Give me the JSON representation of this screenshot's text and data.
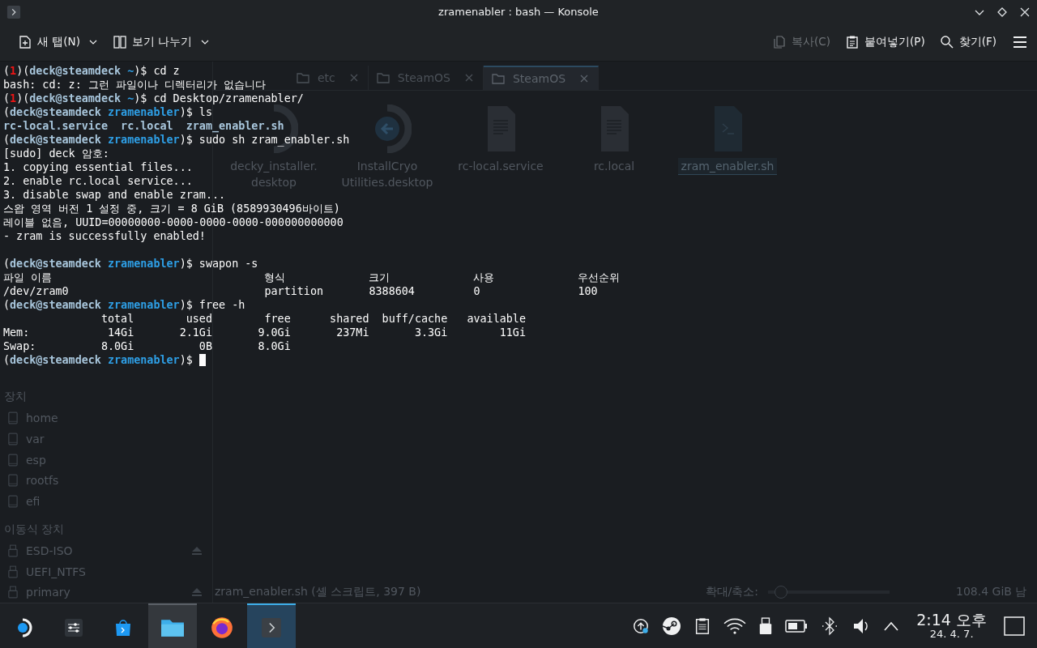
{
  "window": {
    "title": "zramenabler : bash — Konsole"
  },
  "toolbar": {
    "left": [
      {
        "label": "새 탭(N)",
        "kind": "new-tab",
        "disabled": false,
        "dropdown": true
      },
      {
        "label": "보기 나누기",
        "kind": "split",
        "disabled": false,
        "dropdown": true
      }
    ],
    "right": [
      {
        "label": "복사(C)",
        "kind": "copy",
        "disabled": true,
        "dropdown": false
      },
      {
        "label": "붙여넣기(P)",
        "kind": "paste",
        "disabled": false,
        "dropdown": false
      },
      {
        "label": "찾기(F)",
        "kind": "find",
        "disabled": false,
        "dropdown": false
      }
    ]
  },
  "background_window": {
    "tabs": [
      {
        "label": "etc",
        "selected": false
      },
      {
        "label": "SteamOS",
        "selected": false
      },
      {
        "label": "SteamOS",
        "selected": true
      }
    ],
    "sidebar": [
      {
        "kind": "heading",
        "label": "장치"
      },
      {
        "kind": "drive",
        "label": "home"
      },
      {
        "kind": "drive",
        "label": "var"
      },
      {
        "kind": "drive",
        "label": "esp"
      },
      {
        "kind": "drive",
        "label": "rootfs"
      },
      {
        "kind": "drive",
        "label": "efi"
      },
      {
        "kind": "heading",
        "label": "이동식 장치"
      },
      {
        "kind": "usb",
        "label": "ESD-ISO",
        "eject": true
      },
      {
        "kind": "usb",
        "label": "UEFI_NTFS",
        "eject": false
      },
      {
        "kind": "usb",
        "label": "primary",
        "eject": true
      }
    ],
    "files": [
      {
        "kind": "ring",
        "lines": [
          "decky_installer.",
          "desktop"
        ],
        "selected": false
      },
      {
        "kind": "arrow",
        "lines": [
          "InstallCryo",
          "Utilities.desktop"
        ],
        "selected": false
      },
      {
        "kind": "document",
        "lines": [
          "rc-local.service"
        ],
        "selected": false
      },
      {
        "kind": "document",
        "lines": [
          "rc.local"
        ],
        "selected": false
      },
      {
        "kind": "script",
        "lines": [
          "zram_enabler.sh"
        ],
        "selected": true
      }
    ],
    "status_bar": {
      "text": "zram_enabler.sh (셸 스크립트, 397 B)",
      "zoom_label": "확대/축소:",
      "zoom": {
        "level": 0.05
      },
      "free_space": "108.4 GiB 남"
    }
  },
  "terminal": {
    "lines": [
      {
        "kind": "prompt",
        "segments": [
          {
            "text": "(",
            "color": "#fcfcfc"
          },
          {
            "text": "**1**",
            "color": "#ed1515"
          },
          {
            "text": ")(",
            "color": "#fcfcfc"
          },
          {
            "text": "**deck@steamdeck**",
            "color": "#a8c6dc"
          },
          {
            "text": " **~**",
            "color": "#2e9fe6"
          },
          {
            "text": ")$ cd z",
            "color": "#fcfcfc"
          }
        ]
      },
      {
        "kind": "output",
        "text": "bash: cd: z: 그런 파일이나 디렉터리가 없습니다"
      },
      {
        "kind": "prompt",
        "segments": [
          {
            "text": "(",
            "color": "#fcfcfc"
          },
          {
            "text": "**1**",
            "color": "#ed1515"
          },
          {
            "text": ")(",
            "color": "#fcfcfc"
          },
          {
            "text": "**deck@steamdeck**",
            "color": "#a8c6dc"
          },
          {
            "text": " **~**",
            "color": "#2e9fe6"
          },
          {
            "text": ")$ cd Desktop/zramenabler/",
            "color": "#fcfcfc"
          }
        ]
      },
      {
        "kind": "prompt",
        "segments": [
          {
            "text": "(",
            "color": "#fcfcfc"
          },
          {
            "text": "**deck@steamdeck**",
            "color": "#a8c6dc"
          },
          {
            "text": " **zramenabler**",
            "color": "#2e9fe6"
          },
          {
            "text": ")$ ls",
            "color": "#fcfcfc"
          }
        ]
      },
      {
        "kind": "files",
        "names": [
          "rc-local.service",
          "rc.local",
          "zram_enabler.sh"
        ]
      },
      {
        "kind": "prompt",
        "segments": [
          {
            "text": "(",
            "color": "#fcfcfc"
          },
          {
            "text": "**deck@steamdeck**",
            "color": "#a8c6dc"
          },
          {
            "text": " **zramenabler**",
            "color": "#2e9fe6"
          },
          {
            "text": ")$ sudo sh zram_enabler.sh",
            "color": "#fcfcfc"
          }
        ]
      },
      {
        "kind": "output",
        "text": "[sudo] deck 암호:"
      },
      {
        "kind": "output",
        "text": "1. copying essential files..."
      },
      {
        "kind": "output",
        "text": "2. enable rc.local service..."
      },
      {
        "kind": "output",
        "text": "3. disable swap and enable zram..."
      },
      {
        "kind": "output",
        "text": "스왑 영역 버전 1 설정 중, 크기 = 8 GiB (8589930496바이트)"
      },
      {
        "kind": "output",
        "text": "레이블 없음, UUID=00000000-0000-0000-0000-000000000000"
      },
      {
        "kind": "output",
        "text": "- zram is successfully enabled!"
      },
      {
        "kind": "blank"
      },
      {
        "kind": "prompt",
        "segments": [
          {
            "text": "(",
            "color": "#fcfcfc"
          },
          {
            "text": "**deck@steamdeck**",
            "color": "#a8c6dc"
          },
          {
            "text": " **zramenabler**",
            "color": "#2e9fe6"
          },
          {
            "text": ")$ swapon -s",
            "color": "#fcfcfc"
          }
        ]
      },
      {
        "kind": "table",
        "cells": [
          "파일 이름",
          "형식",
          "크기",
          "사용",
          "우선순위"
        ]
      },
      {
        "kind": "table",
        "cells": [
          "/dev/zram0",
          "partition",
          "8388604",
          "0",
          "100"
        ]
      },
      {
        "kind": "prompt",
        "segments": [
          {
            "text": "(",
            "color": "#fcfcfc"
          },
          {
            "text": "**deck@steamdeck**",
            "color": "#a8c6dc"
          },
          {
            "text": " **zramenabler**",
            "color": "#2e9fe6"
          },
          {
            "text": ")$ free -h",
            "color": "#fcfcfc"
          }
        ]
      },
      {
        "kind": "output",
        "text": "               total        used        free      shared  buff/cache   available"
      },
      {
        "kind": "output",
        "text": "Mem:            14Gi       2.1Gi       9.0Gi       237Mi       3.3Gi        11Gi"
      },
      {
        "kind": "output",
        "text": "Swap:          8.0Gi          0B       8.0Gi"
      },
      {
        "kind": "prompt",
        "cursor": true,
        "segments": [
          {
            "text": "(",
            "color": "#fcfcfc"
          },
          {
            "text": "**deck@steamdeck**",
            "color": "#a8c6dc"
          },
          {
            "text": " **zramenabler**",
            "color": "#2e9fe6"
          },
          {
            "text": ")$",
            "color": "#fcfcfc"
          }
        ]
      }
    ]
  },
  "taskbar": {
    "apps": [
      {
        "kind": "deck",
        "open": false,
        "selected": false
      },
      {
        "kind": "settings",
        "open": false,
        "selected": false
      },
      {
        "kind": "store",
        "open": false,
        "selected": false
      },
      {
        "kind": "files",
        "open": true,
        "selected": false
      },
      {
        "kind": "firefox",
        "open": false,
        "selected": false
      },
      {
        "kind": "terminal",
        "selected": true
      }
    ],
    "time": "2:14 오후",
    "date": "24. 4. 7."
  }
}
